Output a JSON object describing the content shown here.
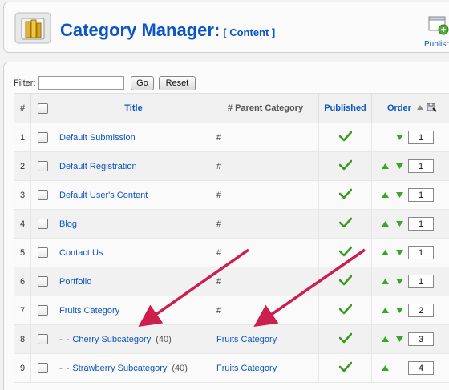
{
  "header": {
    "title": "Category Manager:",
    "subtitle": "[ Content ]",
    "publish_label": "Publish",
    "icon": "category-folder-icon"
  },
  "filter": {
    "label": "Filter:",
    "value": "",
    "go_label": "Go",
    "reset_label": "Reset"
  },
  "table": {
    "columns": {
      "num": "#",
      "title": "Title",
      "parent": "# Parent Category",
      "published": "Published",
      "order": "Order"
    },
    "rows": [
      {
        "num": "1",
        "prefix": "",
        "title": "Default Submission",
        "count": "",
        "parent": "#",
        "parent_is_link": false,
        "order": "1"
      },
      {
        "num": "2",
        "prefix": "",
        "title": "Default Registration",
        "count": "",
        "parent": "#",
        "parent_is_link": false,
        "order": "1"
      },
      {
        "num": "3",
        "prefix": "",
        "title": "Default User's Content",
        "count": "",
        "parent": "#",
        "parent_is_link": false,
        "order": "1"
      },
      {
        "num": "4",
        "prefix": "",
        "title": "Blog",
        "count": "",
        "parent": "#",
        "parent_is_link": false,
        "order": "1"
      },
      {
        "num": "5",
        "prefix": "",
        "title": "Contact Us",
        "count": "",
        "parent": "#",
        "parent_is_link": false,
        "order": "1"
      },
      {
        "num": "6",
        "prefix": "",
        "title": "Portfolio",
        "count": "",
        "parent": "#",
        "parent_is_link": false,
        "order": "1"
      },
      {
        "num": "7",
        "prefix": "",
        "title": "Fruits Category",
        "count": "",
        "parent": "#",
        "parent_is_link": false,
        "order": "2"
      },
      {
        "num": "8",
        "prefix": "- -",
        "title": "Cherry Subcategory",
        "count": "(40)",
        "parent": "Fruits Category",
        "parent_is_link": true,
        "order": "3"
      },
      {
        "num": "9",
        "prefix": "- -",
        "title": "Strawberry Subcategory",
        "count": "(40)",
        "parent": "Fruits Category",
        "parent_is_link": true,
        "order": "4"
      }
    ]
  },
  "colors": {
    "link": "#0b55c4",
    "check": "#3a9a1f",
    "arrow_green": "#3aa529",
    "annotation_arrow": "#cc1f4e"
  }
}
